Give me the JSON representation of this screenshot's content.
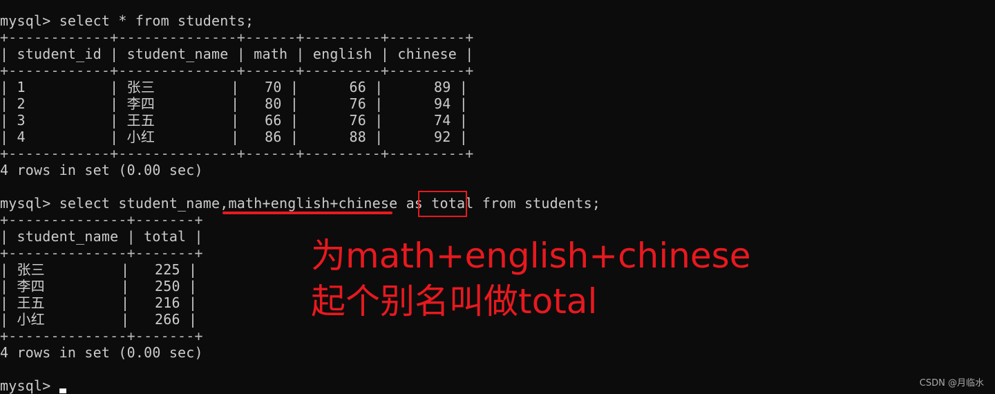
{
  "terminal": {
    "query1": {
      "prompt": "mysql> ",
      "command": "select * from students;",
      "lines": [
        "+------------+--------------+------+---------+---------+",
        "| student_id | student_name | math | english | chinese |",
        "+------------+--------------+------+---------+---------+",
        "| 1          | 张三         |   70 |      66 |      89 |",
        "| 2          | 李四         |   80 |      76 |      94 |",
        "| 3          | 王五         |   66 |      76 |      74 |",
        "| 4          | 小红         |   86 |      88 |      92 |",
        "+------------+--------------+------+---------+---------+"
      ],
      "columns": [
        "student_id",
        "student_name",
        "math",
        "english",
        "chinese"
      ],
      "rows": [
        [
          "1",
          "张三",
          "70",
          "66",
          "89"
        ],
        [
          "2",
          "李四",
          "80",
          "76",
          "94"
        ],
        [
          "3",
          "王五",
          "66",
          "76",
          "74"
        ],
        [
          "4",
          "小红",
          "86",
          "88",
          "92"
        ]
      ],
      "status": "4 rows in set (0.00 sec)"
    },
    "query2": {
      "prompt": "mysql> ",
      "command": "select student_name,math+english+chinese as total from students;",
      "lines": [
        "+--------------+-------+",
        "| student_name | total |",
        "+--------------+-------+",
        "| 张三         |   225 |",
        "| 李四         |   250 |",
        "| 王五         |   216 |",
        "| 小红         |   266 |",
        "+--------------+-------+"
      ],
      "columns": [
        "student_name",
        "total"
      ],
      "rows": [
        [
          "张三",
          "225"
        ],
        [
          "李四",
          "250"
        ],
        [
          "王五",
          "216"
        ],
        [
          "小红",
          "266"
        ]
      ],
      "status": "4 rows in set (0.00 sec)"
    },
    "final_prompt": "mysql> "
  },
  "annotation": {
    "line1": "为math+english+chinese",
    "line2": "起个别名叫做total",
    "color": "#e8191f"
  },
  "watermark": "CSDN @月临水"
}
